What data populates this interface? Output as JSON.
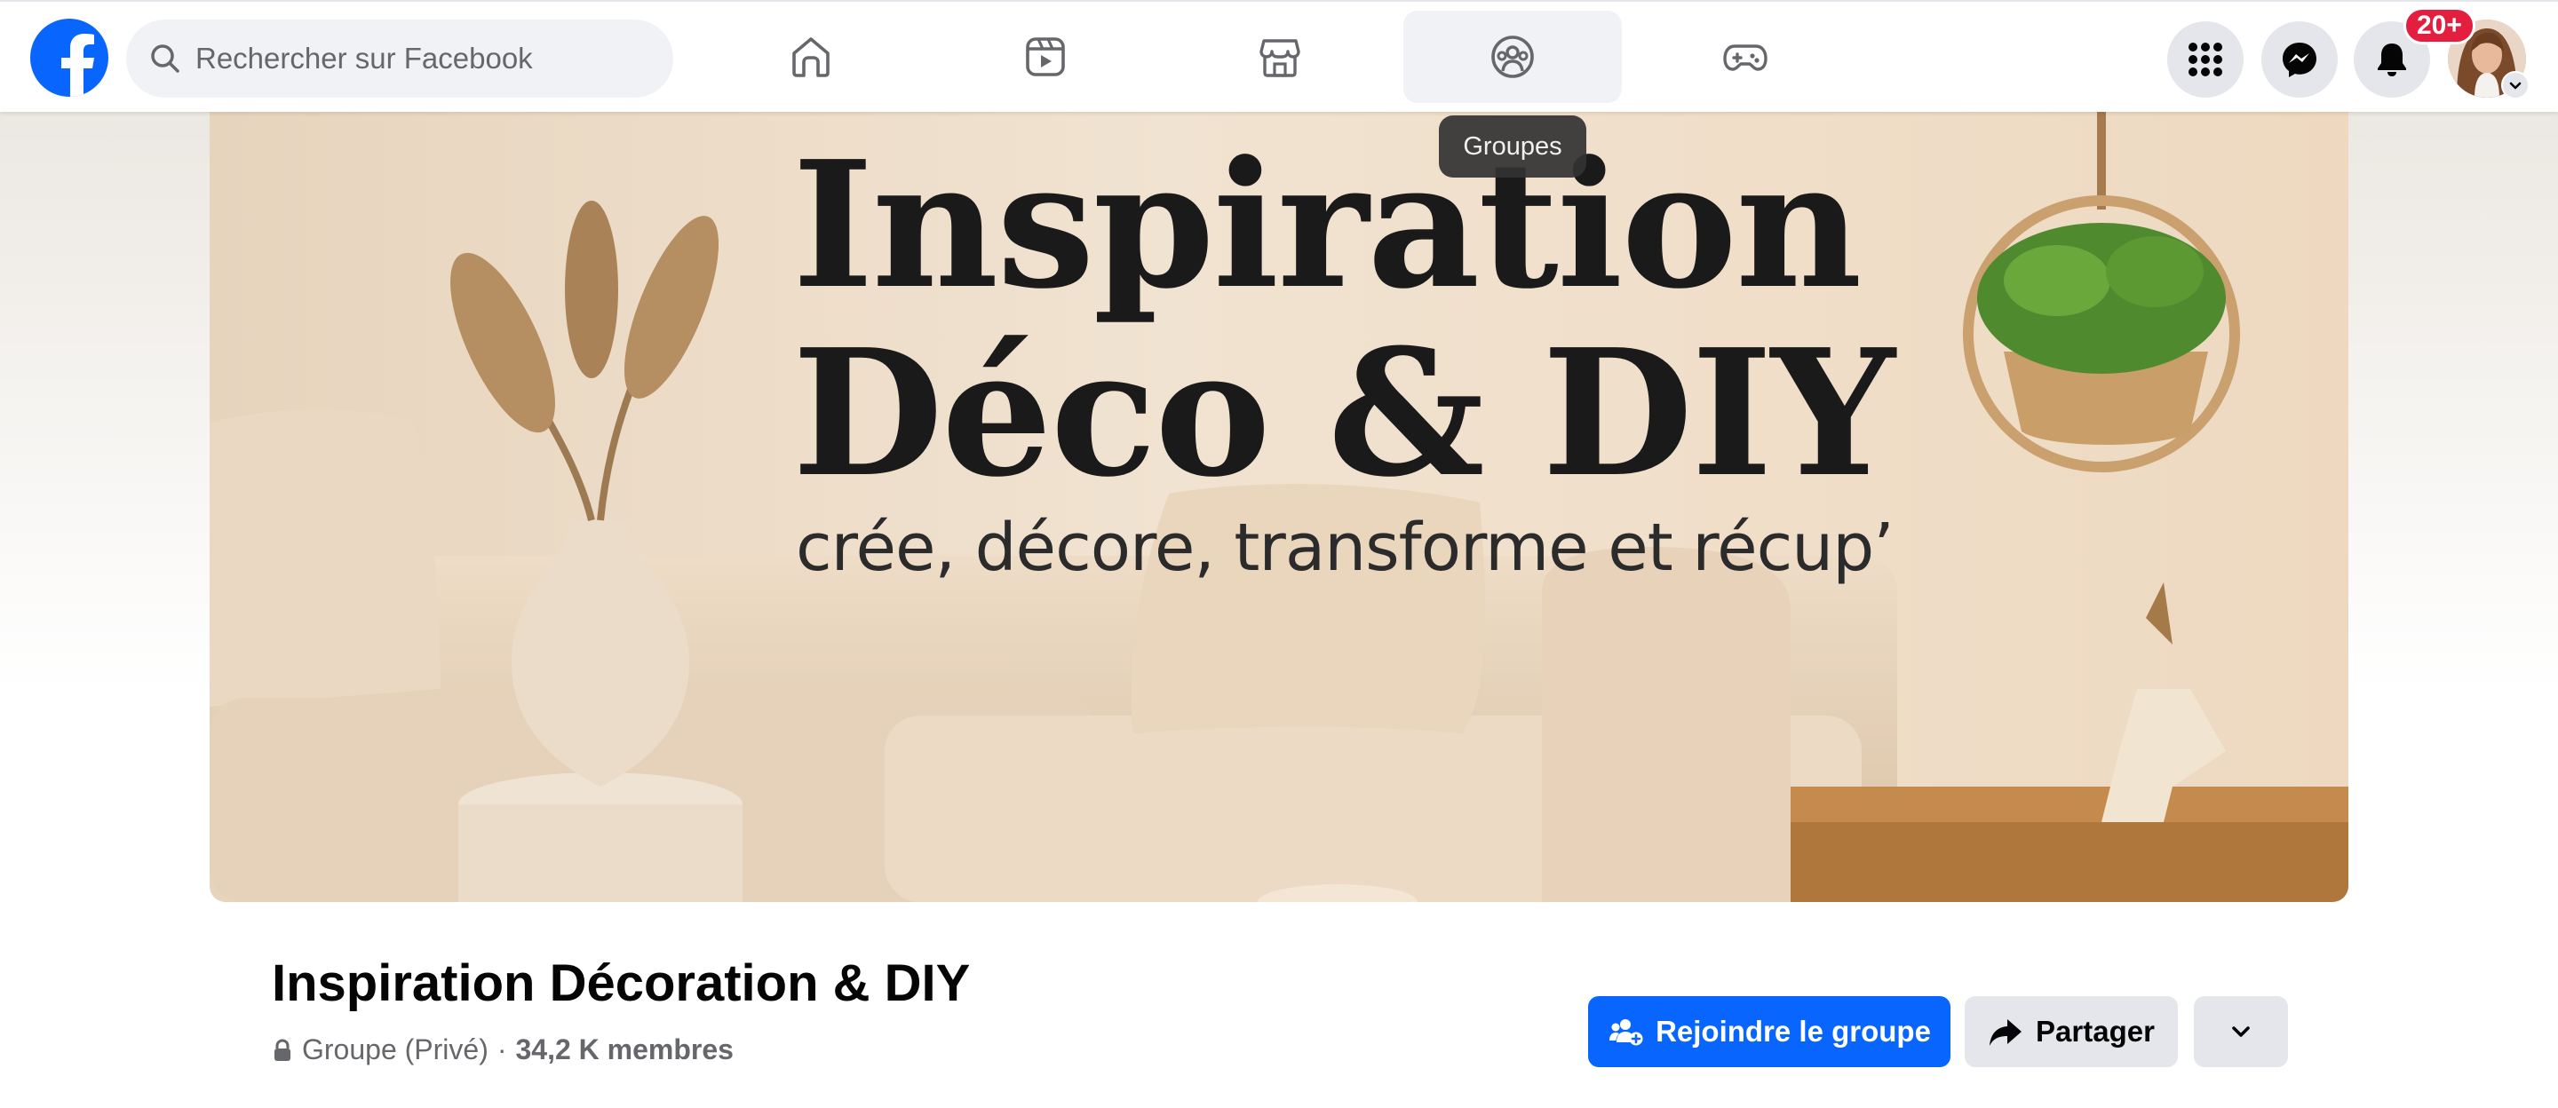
{
  "topbar": {
    "search_placeholder": "Rechercher sur Facebook",
    "nav_tabs": [
      {
        "name": "home",
        "icon": "home-icon"
      },
      {
        "name": "video",
        "icon": "video-icon"
      },
      {
        "name": "marketplace",
        "icon": "marketplace-icon"
      },
      {
        "name": "groups",
        "icon": "groups-icon",
        "active": true
      },
      {
        "name": "gaming",
        "icon": "gaming-icon"
      }
    ],
    "tooltip": "Groupes",
    "notifications_badge": "20+",
    "right_icons": [
      "menu-grid-icon",
      "messenger-icon",
      "bell-icon",
      "avatar"
    ]
  },
  "cover": {
    "title_line1": "Inspiration",
    "title_line2": "Déco & DIY",
    "subtitle": "crée, décore, transforme et récup’"
  },
  "group": {
    "name": "Inspiration Décoration & DIY",
    "privacy": "Groupe (Privé)",
    "separator": "·",
    "members": "34,2 K membres"
  },
  "actions": {
    "join_label": "Rejoindre le groupe",
    "share_label": "Partager"
  },
  "colors": {
    "brand_blue": "#0866ff",
    "badge_red": "#e41e3f",
    "button_gray": "#e4e6eb",
    "text_primary": "#050505",
    "text_secondary": "#65676b"
  }
}
